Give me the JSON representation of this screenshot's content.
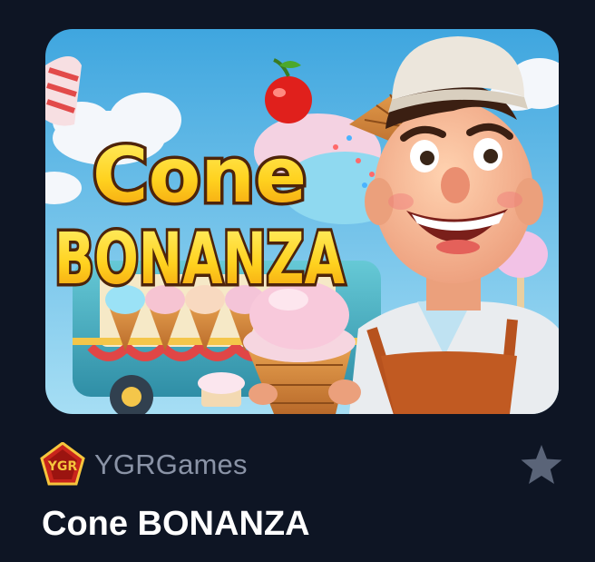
{
  "game": {
    "title": "Cone BONANZA",
    "artwork_title_line1": "Cone",
    "artwork_title_line2": "BONANZA",
    "thumbnail_alt": "Cone BONANZA"
  },
  "provider": {
    "name": "YGRGames",
    "logo_text": "YGR",
    "logo_icon": "ygr-logo-icon"
  },
  "favorite": {
    "icon": "star-icon",
    "active": false
  },
  "colors": {
    "background": "#0e1524",
    "provider_text": "#8a93a6",
    "title_text": "#ffffff",
    "star": "#5a6478",
    "logo_red": "#c8241c",
    "logo_gold": "#f6c53c",
    "art_title_yellow": "#ffd21f",
    "art_title_outline": "#5a2a0c",
    "sky": "#69c3ee"
  }
}
